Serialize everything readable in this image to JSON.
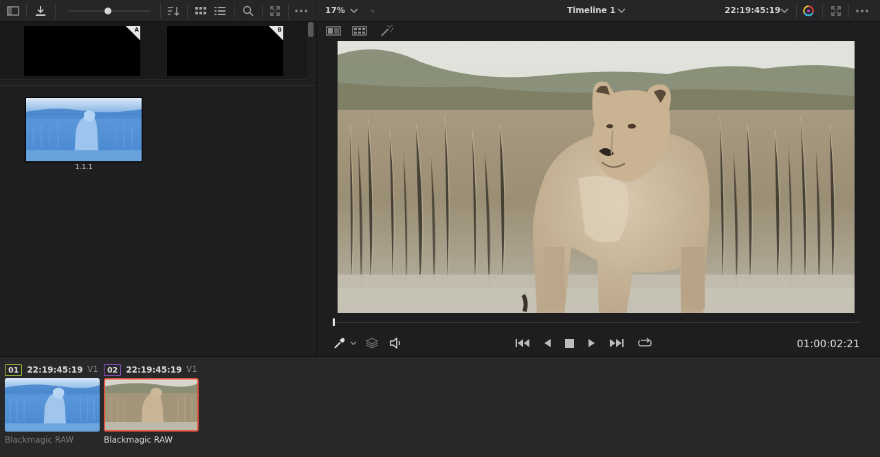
{
  "gallery_toolbar": {
    "icons": [
      "sidebar-toggle-icon",
      "grab-still-icon",
      "thumbnail-size-slider",
      "sort-icon",
      "grid-view-icon",
      "list-view-icon",
      "search-icon",
      "fullscreen-icon",
      "options-icon"
    ],
    "thumbnail_size_level": 0.48
  },
  "stills": [
    {
      "label": "A"
    },
    {
      "label": "B"
    }
  ],
  "album": {
    "still_label": "1.1.1"
  },
  "viewer_toolbar": {
    "zoom": "17%",
    "timeline_name": "Timeline 1",
    "source_timecode": "22:19:45:19"
  },
  "viewer": {
    "playhead_position": 0.0,
    "timecode": "01:00:02:21",
    "transport": [
      "go-to-first-icon",
      "play-reverse-icon",
      "stop-icon",
      "play-icon",
      "go-to-last-icon",
      "loop-icon"
    ]
  },
  "clips": [
    {
      "number": "01",
      "timecode": "22:19:45:19",
      "track": "V1",
      "name": "Blackmagic RAW",
      "selected": false,
      "badge_color": "#a8d43b"
    },
    {
      "number": "02",
      "timecode": "22:19:45:19",
      "track": "V1",
      "name": "Blackmagic RAW",
      "selected": true,
      "badge_color": "#9a5ad8"
    }
  ],
  "colors": {
    "selection_border": "#e0503a",
    "background": "#1e1e20"
  }
}
